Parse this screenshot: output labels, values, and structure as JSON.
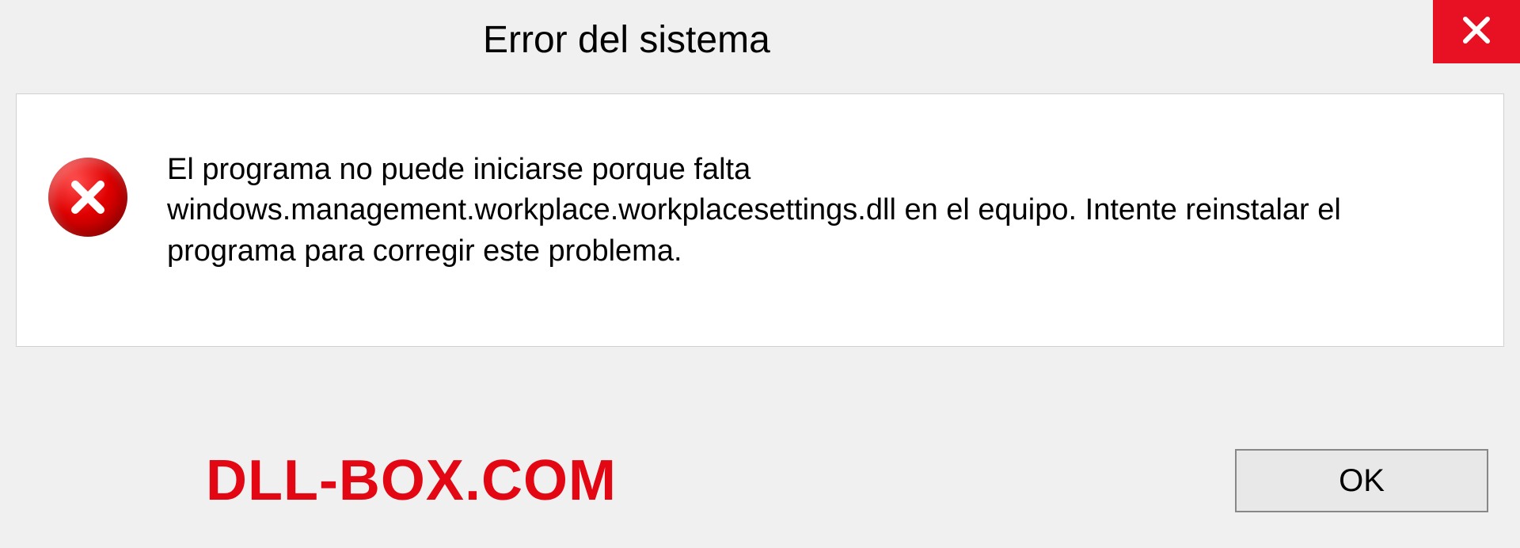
{
  "dialog": {
    "title": "Error del sistema",
    "message": "El programa no puede iniciarse porque falta windows.management.workplace.workplacesettings.dll en el equipo. Intente reinstalar el programa para corregir este problema.",
    "ok_label": "OK"
  },
  "watermark": {
    "text": "DLL-BOX.COM"
  },
  "colors": {
    "close_bg": "#e81123",
    "error_icon": "#d40000",
    "watermark": "#e30613"
  }
}
